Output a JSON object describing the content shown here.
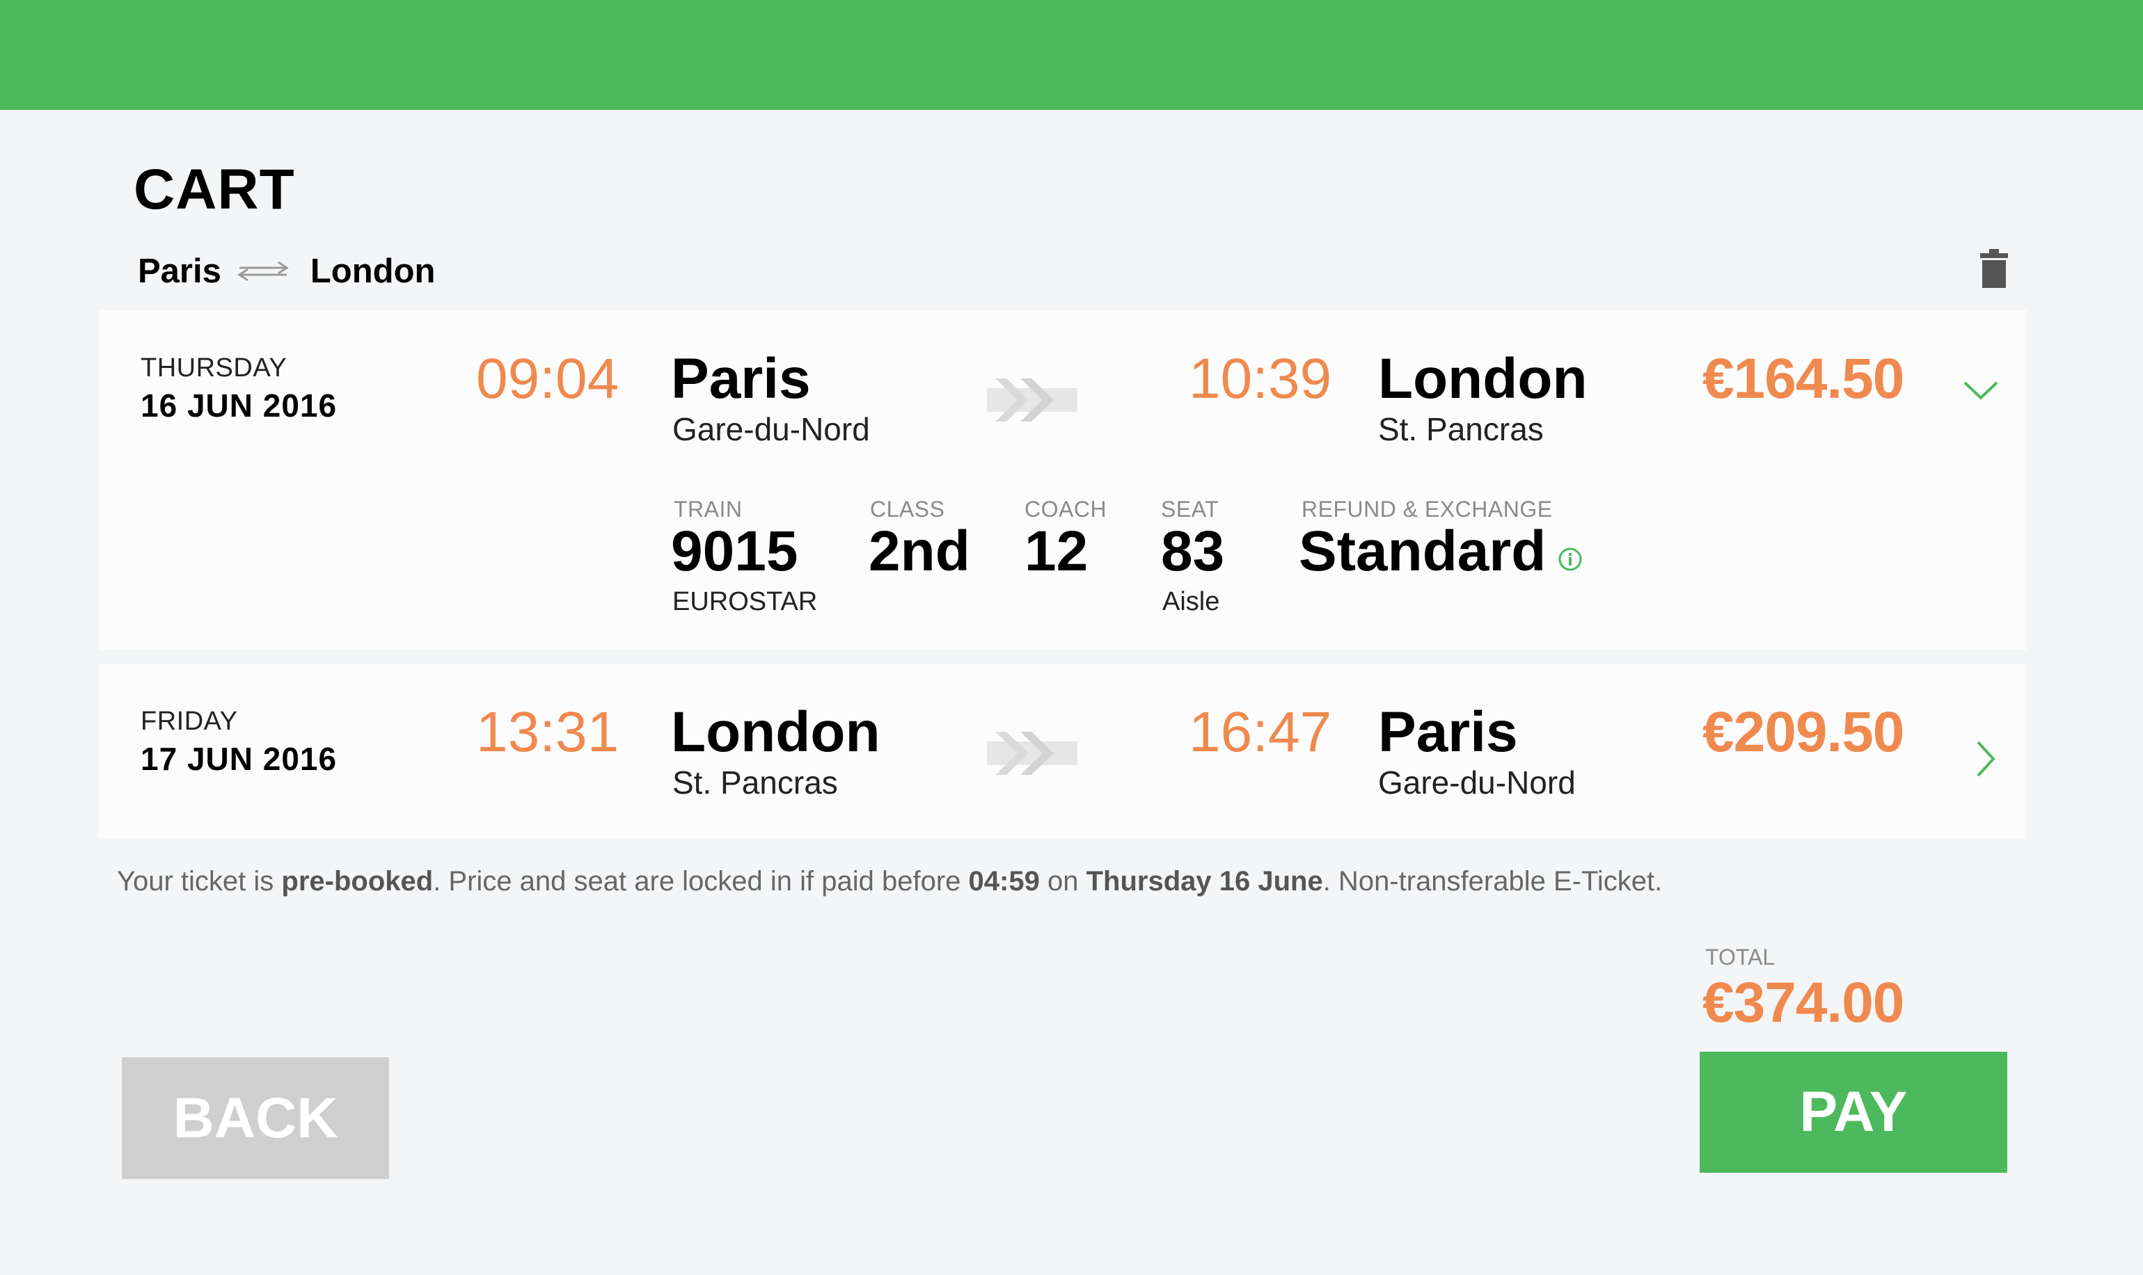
{
  "header": {
    "bar_color": "#4cb95c"
  },
  "page": {
    "title": "CART"
  },
  "route": {
    "from": "Paris",
    "to": "London",
    "swap_icon": "swap-arrows-icon",
    "delete_icon": "trash-icon"
  },
  "trips": [
    {
      "day": "THURSDAY",
      "date": "16 JUN 2016",
      "depart_time": "09:04",
      "depart_city": "Paris",
      "depart_station": "Gare-du-Nord",
      "arrive_time": "10:39",
      "arrive_city": "London",
      "arrive_station": "St. Pancras",
      "price": "€164.50",
      "expanded": true,
      "details": {
        "train_label": "TRAIN",
        "train": "9015",
        "operator": "EUROSTAR",
        "class_label": "CLASS",
        "class": "2nd",
        "coach_label": "COACH",
        "coach": "12",
        "seat_label": "SEAT",
        "seat": "83",
        "seat_position": "Aisle",
        "refund_label": "REFUND & EXCHANGE",
        "refund": "Standard"
      }
    },
    {
      "day": "FRIDAY",
      "date": "17 JUN 2016",
      "depart_time": "13:31",
      "depart_city": "London",
      "depart_station": "St. Pancras",
      "arrive_time": "16:47",
      "arrive_city": "Paris",
      "arrive_station": "Gare-du-Nord",
      "price": "€209.50",
      "expanded": false
    }
  ],
  "notice": {
    "t1": "Your ticket is ",
    "b1": "pre-booked",
    "t2": ". Price and seat are locked in if paid before ",
    "b2": "04:59",
    "t3": " on ",
    "b3": "Thursday 16 June",
    "t4": ". Non-transferable E-Ticket."
  },
  "total": {
    "label": "TOTAL",
    "value": "€374.00"
  },
  "buttons": {
    "back": "BACK",
    "pay": "PAY"
  },
  "colors": {
    "accent": "#4cb95c",
    "price": "#f0894e",
    "back_button": "#cfcfcf"
  }
}
